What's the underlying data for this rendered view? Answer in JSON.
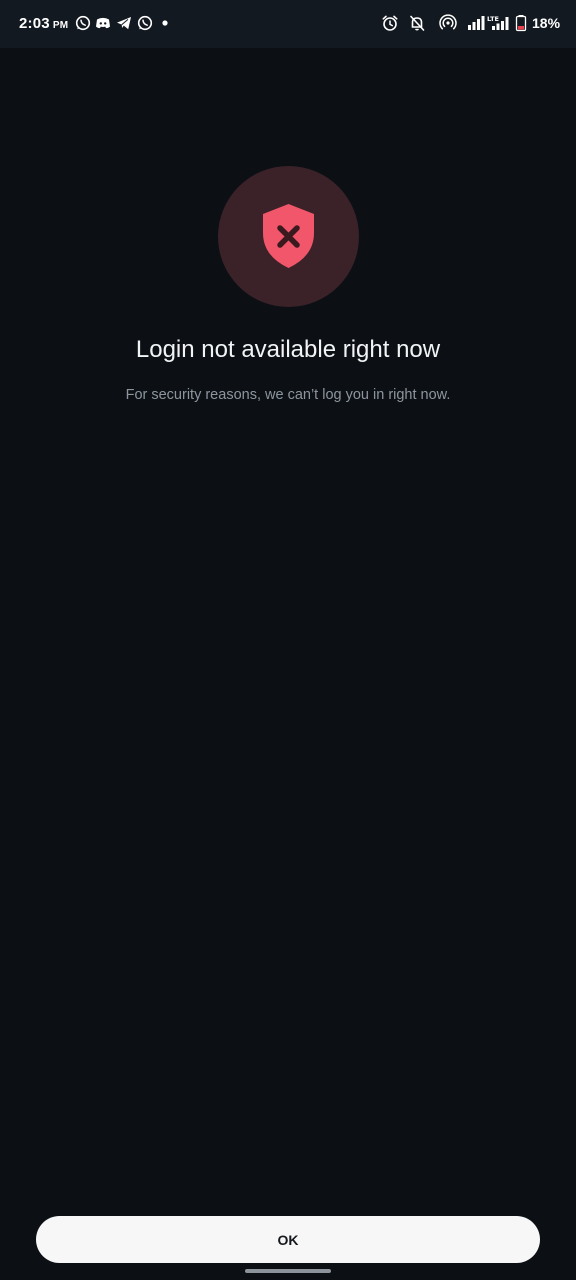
{
  "status_bar": {
    "time": "2:03",
    "ampm": "PM",
    "battery_percent": "18%",
    "left_icons": [
      "whatsapp-icon",
      "discord-icon",
      "telegram-icon",
      "whatsapp-business-icon",
      "notification-dot-icon"
    ],
    "right_icons": [
      "alarm-icon",
      "bell-off-icon",
      "hotspot-icon",
      "signal-icon",
      "lte-signal-icon",
      "battery-icon"
    ]
  },
  "dialog": {
    "icon": "shield-x-icon",
    "title": "Login not available right now",
    "message": "For security reasons, we can’t log you in right now.",
    "ok_label": "OK"
  },
  "colors": {
    "background": "#0c1014",
    "accent": "#f2566a",
    "icon_circle": "#3a2228",
    "button": "#f7f7f7"
  }
}
